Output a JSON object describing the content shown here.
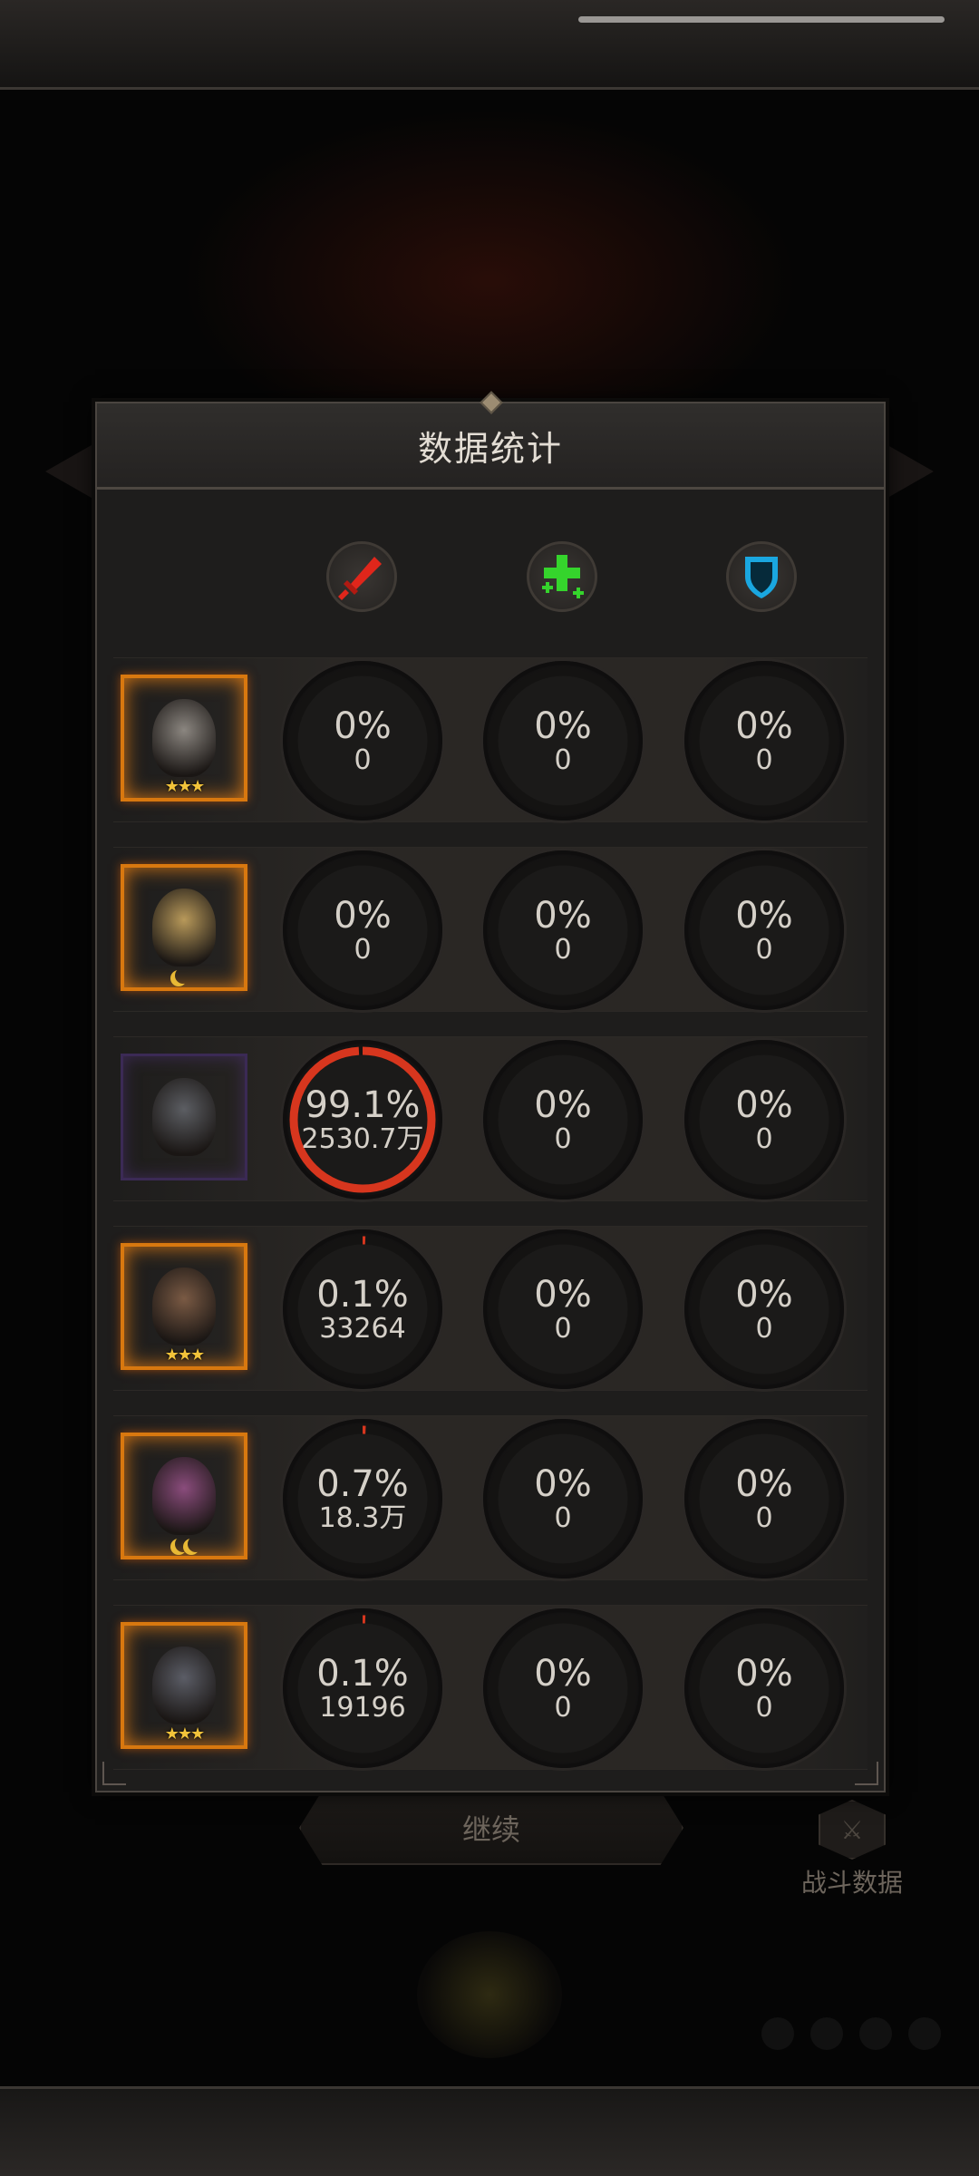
{
  "panel": {
    "title": "数据统计",
    "columns": [
      {
        "icon": "sword-icon",
        "color": "#e0261b"
      },
      {
        "icon": "heal-cross-icon",
        "color": "#35d42c"
      },
      {
        "icon": "shield-icon",
        "color": "#1aa7e0"
      }
    ],
    "rows": [
      {
        "avatar": "hero-avatar-silver-crown",
        "rank": "stars",
        "frame": "orange",
        "damage": {
          "pct": "0%",
          "value": "0",
          "ratio": 0
        },
        "heal": {
          "pct": "0%",
          "value": "0",
          "ratio": 0
        },
        "defense": {
          "pct": "0%",
          "value": "0",
          "ratio": 0
        }
      },
      {
        "avatar": "hero-avatar-blonde",
        "rank": "moon",
        "frame": "orange",
        "damage": {
          "pct": "0%",
          "value": "0",
          "ratio": 0
        },
        "heal": {
          "pct": "0%",
          "value": "0",
          "ratio": 0
        },
        "defense": {
          "pct": "0%",
          "value": "0",
          "ratio": 0
        }
      },
      {
        "avatar": "hero-avatar-armored-knight",
        "rank": "",
        "frame": "purple",
        "damage": {
          "pct": "99.1%",
          "value": "2530.7万",
          "ratio": 0.991
        },
        "heal": {
          "pct": "0%",
          "value": "0",
          "ratio": 0
        },
        "defense": {
          "pct": "0%",
          "value": "0",
          "ratio": 0
        }
      },
      {
        "avatar": "hero-avatar-dark-hair-woman",
        "rank": "stars",
        "frame": "orange",
        "damage": {
          "pct": "0.1%",
          "value": "33264",
          "ratio": 0.001
        },
        "heal": {
          "pct": "0%",
          "value": "0",
          "ratio": 0
        },
        "defense": {
          "pct": "0%",
          "value": "0",
          "ratio": 0
        }
      },
      {
        "avatar": "hero-avatar-purple-hair",
        "rank": "double-moon",
        "frame": "orange",
        "damage": {
          "pct": "0.7%",
          "value": "18.3万",
          "ratio": 0.007
        },
        "heal": {
          "pct": "0%",
          "value": "0",
          "ratio": 0
        },
        "defense": {
          "pct": "0%",
          "value": "0",
          "ratio": 0
        }
      },
      {
        "avatar": "hero-avatar-werewolf",
        "rank": "stars",
        "frame": "orange",
        "damage": {
          "pct": "0.1%",
          "value": "19196",
          "ratio": 0.001
        },
        "heal": {
          "pct": "0%",
          "value": "0",
          "ratio": 0
        },
        "defense": {
          "pct": "0%",
          "value": "0",
          "ratio": 0
        }
      }
    ]
  },
  "background": {
    "continue_label": "继续",
    "battle_data_label": "战斗数据"
  },
  "colors": {
    "ring_damage": "#d7361e",
    "ring_track": "#141312",
    "frame_orange": "#d8780f",
    "frame_purple": "#3b2a55"
  }
}
